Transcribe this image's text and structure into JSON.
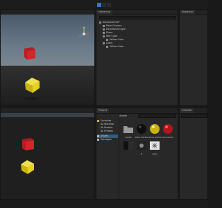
{
  "toolbar": {
    "play_icon": "play-icon",
    "pause_icon": "pause-icon",
    "step_icon": "step-icon"
  },
  "hierarchy": {
    "tab": "Hierarchy",
    "scene": "SampleScene*",
    "items": [
      "Main Camera",
      "Directional Light",
      "Plane",
      "Red Cube",
      "Yellow Cube",
      "Lotus",
      "Yellow Cube"
    ]
  },
  "inspector": {
    "tab": "Inspector"
  },
  "project": {
    "tab": "Project",
    "console_tab": "Console",
    "favorites": "Favorites",
    "favorite_items": [
      "All Material",
      "All Models",
      "All Prefabs"
    ],
    "folders": [
      "Assets",
      "Packages"
    ],
    "breadcrumb": "Assets",
    "assets_row1": [
      "Assets",
      "Black Marble",
      "Yellow Marble",
      "Red Marble",
      "Red Marble"
    ],
    "assets_row2": [
      "",
      "B",
      "Lotus"
    ]
  },
  "colors": {
    "accent": "#3a79bb",
    "red_cube": "#d4252a",
    "yellow_cube": "#e6d21a"
  }
}
